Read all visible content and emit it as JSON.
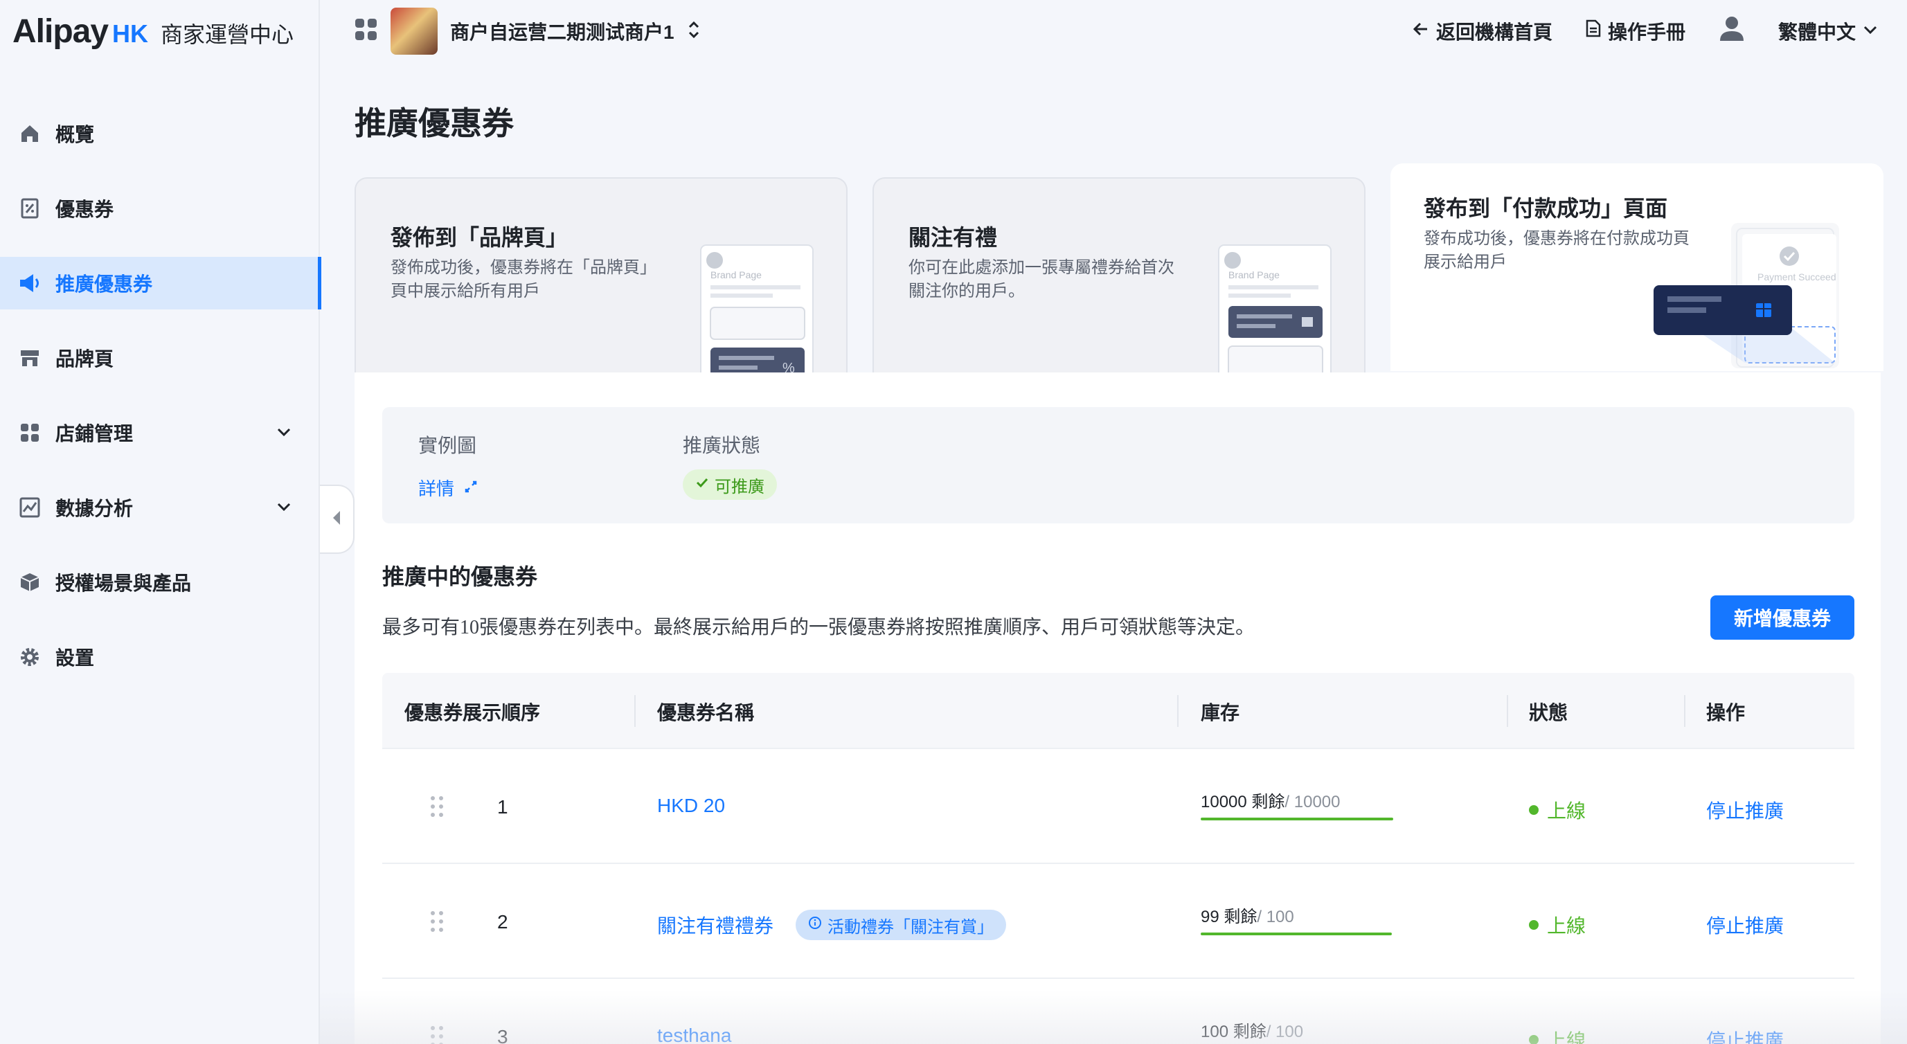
{
  "brand": {
    "logo_main": "Alipay",
    "logo_hk": "HK",
    "center_name": "商家運營中心"
  },
  "topbar": {
    "merchant_name": "商户自运营二期测试商户1",
    "back_link": "返回機構首頁",
    "manual_link": "操作手冊",
    "language": "繁體中文"
  },
  "sidebar": {
    "items": [
      {
        "label": "概覽",
        "icon": "home-icon"
      },
      {
        "label": "優惠券",
        "icon": "coupon-icon"
      },
      {
        "label": "推廣優惠券",
        "icon": "megaphone-icon",
        "active": true
      },
      {
        "label": "品牌頁",
        "icon": "store-icon"
      },
      {
        "label": "店鋪管理",
        "icon": "grid-icon",
        "expandable": true
      },
      {
        "label": "數據分析",
        "icon": "chart-icon",
        "expandable": true
      },
      {
        "label": "授權場景與產品",
        "icon": "box-icon"
      },
      {
        "label": "設置",
        "icon": "gear-icon"
      }
    ]
  },
  "page": {
    "title": "推廣優惠券"
  },
  "cards": [
    {
      "title": "發佈到「品牌頁」",
      "desc": "發佈成功後，優惠券將在「品牌頁」頁中展示給所有用戶",
      "preview_label": "Brand Page"
    },
    {
      "title": "關注有禮",
      "desc": "你可在此處添加一張專屬禮券給首次關注你的用戶。",
      "preview_label": "Brand Page"
    },
    {
      "title": "發布到「付款成功」頁面",
      "desc": "發布成功後，優惠券將在付款成功頁展示給用戶",
      "preview_label": "Payment Succeed",
      "selected": true
    }
  ],
  "example": {
    "label_example": "實例圖",
    "label_status": "推廣狀態",
    "detail_link": "詳情",
    "status_badge": "可推廣"
  },
  "section": {
    "title": "推廣中的優惠券",
    "desc": "最多可有10張優惠券在列表中。最終展示給用戶的一張優惠券將按照推廣順序、用戶可領狀態等決定。",
    "add_button": "新增優惠券"
  },
  "table": {
    "headers": [
      "優惠券展示順序",
      "優惠券名稱",
      "庫存",
      "狀態",
      "操作"
    ],
    "rows": [
      {
        "order": "1",
        "name": "HKD 20",
        "tag": "",
        "stock_remaining": "10000 剩餘",
        "stock_total": "/ 10000",
        "status": "上線",
        "action": "停止推廣"
      },
      {
        "order": "2",
        "name": "關注有禮禮券",
        "tag": "活動禮券「關注有賞」",
        "stock_remaining": "99 剩餘",
        "stock_total": "/ 100",
        "status": "上線",
        "action": "停止推廣"
      },
      {
        "order": "3",
        "name": "testhana",
        "tag": "",
        "stock_remaining": "100 剩餘",
        "stock_total": "/ 100",
        "status": "上線",
        "action": "停止推廣"
      }
    ]
  },
  "colors": {
    "accent": "#1677ff",
    "success": "#52b72c",
    "active_bg": "#d9e8fd"
  }
}
